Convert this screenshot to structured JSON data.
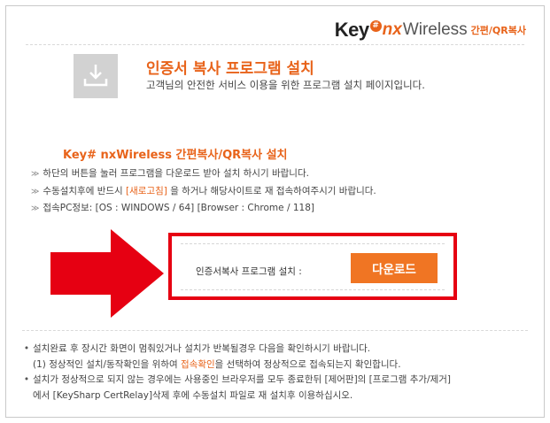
{
  "logo": {
    "key": "Key",
    "badge": "#",
    "nx": "nx",
    "wireless": "Wireless",
    "sub": "간편/QR복사"
  },
  "header": {
    "title": "인증서 복사 프로그램 설치",
    "description": "고객님의 안전한 서비스 이용을 위한 프로그램 설치 페이지입니다.",
    "icon": "download-icon"
  },
  "section": {
    "title": "Key# nxWireless 간편복사/QR복사 설치",
    "lines": [
      {
        "mark": "≫",
        "text": "하단의 버튼을 눌러 프로그램을 다운로드 받아 설치 하시기 바랍니다."
      },
      {
        "mark": "≫",
        "pre": "수동설치후에 반드시 ",
        "highlight": "[새로고침]",
        "post": " 을 하거나 해당사이트로 재 접속하여주시기 바랍니다."
      },
      {
        "mark": "≫",
        "text": "접속PC정보: [OS : WINDOWS / 64] [Browser : Chrome / 118]"
      }
    ]
  },
  "install": {
    "label": "인증서복사 프로그램 설치 :",
    "button": "다운로드"
  },
  "notes": {
    "bullet": "•",
    "line1": "설치완료 후 장시간 화면이 멈춰있거나 설치가 반복될경우 다음을 확인하시기 바랍니다.",
    "line2_pre": "(1) 정상적인 설치/동작확인을 위하여 ",
    "line2_highlight": "접속확인",
    "line2_post": "을 선택하여 정상적으로 접속되는지 확인합니다.",
    "line3": "설치가 정상적으로 되지 않는 경우에는 사용중인 브라우저를 모두 종료한뒤 [제어판]의 [프로그램 추가/제거]",
    "line4": "에서 [KeySharp CertRelay]삭제 후에 수동설치 파일로 재 설치후 이용하십시오."
  },
  "colors": {
    "accent": "#e8631a",
    "button": "#f07523",
    "highlight_box": "#e60012",
    "arrow": "#e60012"
  }
}
